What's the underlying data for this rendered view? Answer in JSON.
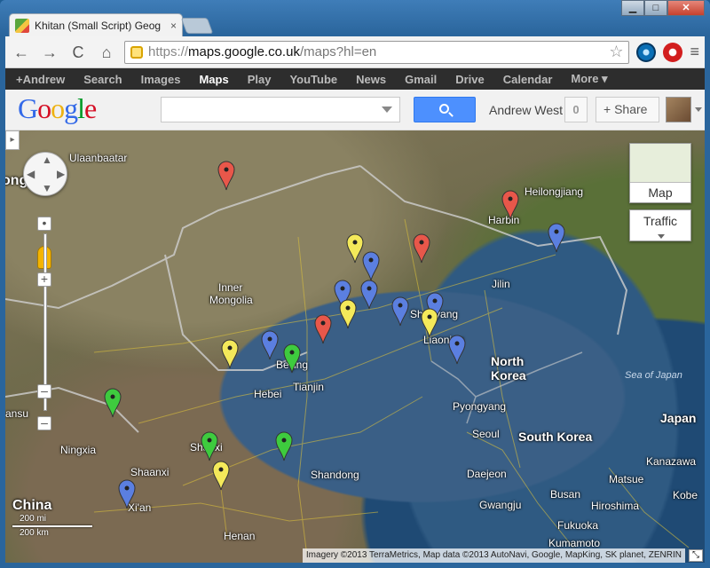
{
  "window": {
    "tab_title": "Khitan (Small Script) Geog",
    "tab_close": "×",
    "minimize": "▁",
    "maximize": "□",
    "close": "✕"
  },
  "toolbar": {
    "back": "←",
    "forward": "→",
    "reload": "C",
    "home": "⌂",
    "url_scheme": "https://",
    "url_host": "maps.google.co.uk",
    "url_rest": "/maps?hl=en",
    "star": "☆",
    "menu": "≡"
  },
  "gbar": [
    "+Andrew",
    "Search",
    "Images",
    "Maps",
    "Play",
    "YouTube",
    "News",
    "Gmail",
    "Drive",
    "Calendar",
    "More ▾"
  ],
  "gbar_active": "Maps",
  "header": {
    "logo": [
      "G",
      "o",
      "o",
      "g",
      "l",
      "e"
    ],
    "logo_colors": [
      "#3369e8",
      "#d50f25",
      "#eeb211",
      "#3369e8",
      "#009925",
      "#d50f25"
    ],
    "search_value": "",
    "user_name": "Andrew West",
    "notification_count": "0",
    "share_label": "+ Share"
  },
  "map": {
    "labels": {
      "ulaanbaatar": "Ulaanbaatar",
      "mongolia_edge": "ongo",
      "heilongjiang": "Heilongjiang",
      "harbin": "Harbin",
      "inner_mongolia_1": "Inner",
      "inner_mongolia_2": "Mongolia",
      "jilin": "Jilin",
      "shenyang": "Shenyang",
      "liaoning": "Liaoning",
      "beijing": "Beijing",
      "tianjin": "Tianjin",
      "hebei": "Hebei",
      "north_korea_1": "North",
      "north_korea_2": "Korea",
      "sea_of_japan": "Sea of Japan",
      "pyongyang": "Pyongyang",
      "japan": "Japan",
      "gansu": "ansu",
      "ningxia": "Ningxia",
      "shaanxi": "Shaanxi",
      "shanxi": "Shanxi",
      "shandong": "Shandong",
      "seoul": "Seoul",
      "south_korea": "South Korea",
      "daejeon": "Daejeon",
      "busan": "Busan",
      "gwangju": "Gwangju",
      "kanazawa": "Kanazawa",
      "matsue": "Matsue",
      "kobe": "Kobe",
      "hiroshima": "Hiroshima",
      "fukuoka": "Fukuoka",
      "kumamoto": "Kumamoto",
      "china": "China",
      "xian": "Xi'an",
      "henan": "Henan"
    },
    "markers": [
      {
        "color": "#e8574a"
      },
      {
        "color": "#e8574a"
      },
      {
        "color": "#e8574a"
      },
      {
        "color": "#e8574a"
      },
      {
        "color": "#5b7fe0"
      },
      {
        "color": "#5b7fe0"
      },
      {
        "color": "#5b7fe0"
      },
      {
        "color": "#5b7fe0"
      },
      {
        "color": "#5b7fe0"
      },
      {
        "color": "#5b7fe0"
      },
      {
        "color": "#5b7fe0"
      },
      {
        "color": "#5b7fe0"
      },
      {
        "color": "#f4e95a"
      },
      {
        "color": "#f4e95a"
      },
      {
        "color": "#f4e95a"
      },
      {
        "color": "#f4e95a"
      },
      {
        "color": "#f4e95a"
      },
      {
        "color": "#3ecb3e"
      },
      {
        "color": "#3ecb3e"
      },
      {
        "color": "#3ecb3e"
      },
      {
        "color": "#3ecb3e"
      },
      {
        "color": "#5b7fe0"
      }
    ],
    "map_type_label": "Map",
    "traffic_label": "Traffic",
    "scale_mi": "200 mi",
    "scale_km": "200 km",
    "attribution": "Imagery ©2013 TerraMetrics, Map data ©2013 AutoNavi, Google, MapKing, SK planet, ZENRIN"
  }
}
